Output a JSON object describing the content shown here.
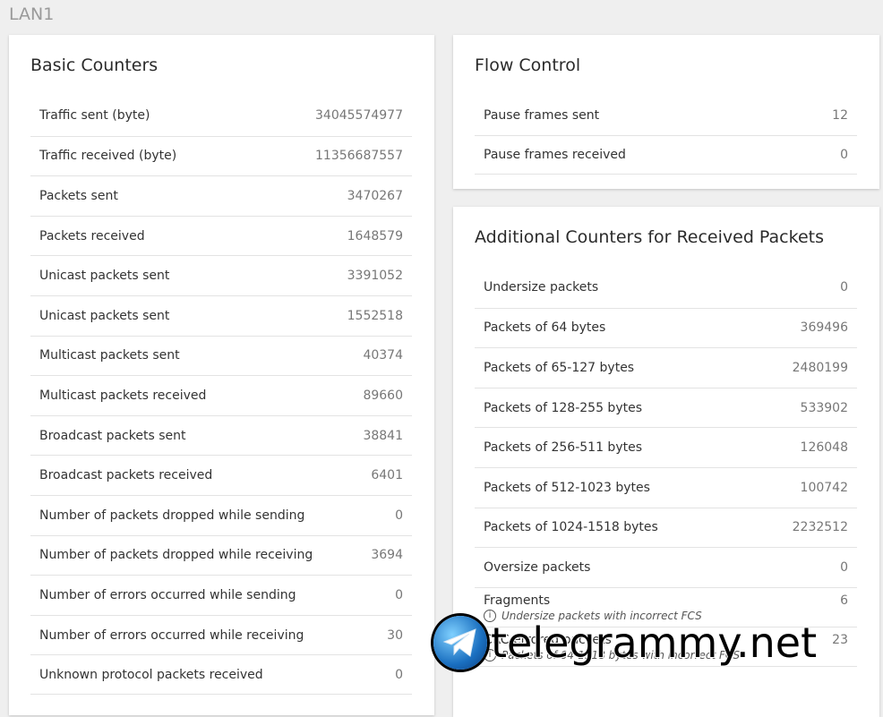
{
  "page": {
    "title": "LAN1"
  },
  "basic_counters": {
    "title": "Basic Counters",
    "rows": [
      {
        "label": "Traffic sent (byte)",
        "value": "34045574977"
      },
      {
        "label": "Traffic received (byte)",
        "value": "11356687557"
      },
      {
        "label": "Packets sent",
        "value": "3470267"
      },
      {
        "label": "Packets received",
        "value": "1648579"
      },
      {
        "label": "Unicast packets sent",
        "value": "3391052"
      },
      {
        "label": "Unicast packets sent",
        "value": "1552518"
      },
      {
        "label": "Multicast packets sent",
        "value": "40374"
      },
      {
        "label": "Multicast packets received",
        "value": "89660"
      },
      {
        "label": "Broadcast packets sent",
        "value": "38841"
      },
      {
        "label": "Broadcast packets received",
        "value": "6401"
      },
      {
        "label": "Number of packets dropped while sending",
        "value": "0"
      },
      {
        "label": "Number of packets dropped while receiving",
        "value": "3694"
      },
      {
        "label": "Number of errors occurred while sending",
        "value": "0"
      },
      {
        "label": "Number of errors occurred while receiving",
        "value": "30"
      },
      {
        "label": "Unknown protocol packets received",
        "value": "0"
      }
    ]
  },
  "flow_control": {
    "title": "Flow Control",
    "rows": [
      {
        "label": "Pause frames sent",
        "value": "12"
      },
      {
        "label": "Pause frames received",
        "value": "0"
      }
    ]
  },
  "additional_counters": {
    "title": "Additional Counters for Received Packets",
    "rows": [
      {
        "label": "Undersize packets",
        "value": "0"
      },
      {
        "label": "Packets of 64 bytes",
        "value": "369496"
      },
      {
        "label": "Packets of 65-127 bytes",
        "value": "2480199"
      },
      {
        "label": "Packets of 128-255 bytes",
        "value": "533902"
      },
      {
        "label": "Packets of 256-511 bytes",
        "value": "126048"
      },
      {
        "label": "Packets of 512-1023 bytes",
        "value": "100742"
      },
      {
        "label": "Packets of 1024-1518 bytes",
        "value": "2232512"
      },
      {
        "label": "Oversize packets",
        "value": "0"
      }
    ],
    "fragments": {
      "label": "Fragments",
      "value": "6",
      "note": "Undersize packets with incorrect FCS"
    },
    "crc": {
      "label": "CRC errored packets",
      "value": "23",
      "note": "Packets of 64-1518 bytes with incorrect FCS"
    }
  },
  "watermark": {
    "text": "telegrammy.net"
  },
  "icons": {
    "info": "info-circle-icon",
    "logo": "telegram-logo-icon"
  }
}
